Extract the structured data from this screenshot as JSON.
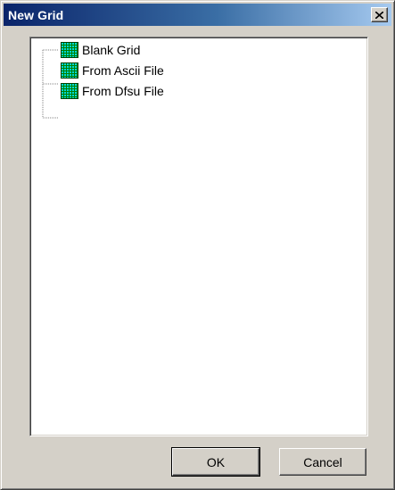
{
  "window": {
    "title": "New Grid",
    "close_label": "×"
  },
  "tree": {
    "items": [
      {
        "label": "Blank Grid",
        "icon": "grid-icon"
      },
      {
        "label": "From Ascii File",
        "icon": "grid-icon"
      },
      {
        "label": "From Dfsu File",
        "icon": "grid-icon"
      }
    ]
  },
  "buttons": {
    "ok_label": "OK",
    "cancel_label": "Cancel"
  },
  "colors": {
    "titlebar_start": "#0a246a",
    "titlebar_end": "#a6caf0",
    "dialog_face": "#d4d0c8",
    "icon_cell": "#00d8d8",
    "icon_grid_line": "#008000"
  }
}
